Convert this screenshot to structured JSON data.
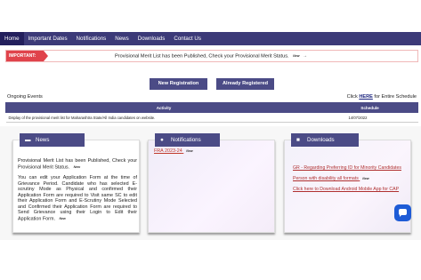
{
  "nav": {
    "items": [
      {
        "label": "Home"
      },
      {
        "label": "Important Dates"
      },
      {
        "label": "Notifications"
      },
      {
        "label": "News"
      },
      {
        "label": "Downloads"
      },
      {
        "label": "Contact Us"
      }
    ]
  },
  "important": {
    "label": "IMPORTANT:",
    "text": "Provisional Merit List has been Published, Check your Provisional Merit Status.",
    "badge": "New",
    "arrow": "→"
  },
  "buttons": {
    "new_registration": "New Registration",
    "already_registered": "Already Registered"
  },
  "ongoing": {
    "title": "Ongoing Events",
    "click_prefix": "Click ",
    "click_link": "HERE",
    "click_suffix": " for Entire Schedule"
  },
  "events_table": {
    "headers": [
      "Activity",
      "Schedule"
    ],
    "rows": [
      {
        "activity": "Display of the provisional merit list for Maharashtra State/All India candidates on website.",
        "schedule": "14/07/2022"
      }
    ]
  },
  "news": {
    "title": "News",
    "icon": "newspaper-icon",
    "items": [
      {
        "text": "Provisional Merit List has been Published, Check your Provisional Merit Status.",
        "badge": "New"
      },
      {
        "text": "You can edit your Application Form at the time of Grievance Period. Candidate who has selected E-scrutiny Mode as Physical and confirmed their Application Form are required to Visit same SC to edit their Application Form and E-Scrutiny Mode Selected and Confirmed their Application Form are required to Send Grievance using their Login to Edit their Application Form.",
        "badge": "New"
      }
    ]
  },
  "notifications": {
    "title": "Notifications",
    "icon": "bell-icon",
    "items": [
      {
        "text": "FRA 2023-24",
        "badge": "New"
      }
    ]
  },
  "downloads": {
    "title": "Downloads",
    "icon": "download-icon",
    "items": [
      {
        "text": "GR - Regarding Preferring ID for Minority Candidates"
      },
      {
        "text": "Person with disability all formats",
        "badge": "New"
      },
      {
        "text": "Click here to Download Android Mobile App for CAP"
      }
    ]
  },
  "chat": {
    "icon": "chat-icon"
  },
  "colors": {
    "nav": "#3c3a78",
    "accent": "#4b4b86",
    "important": "#e0434b",
    "chat": "#1e5bd6"
  }
}
